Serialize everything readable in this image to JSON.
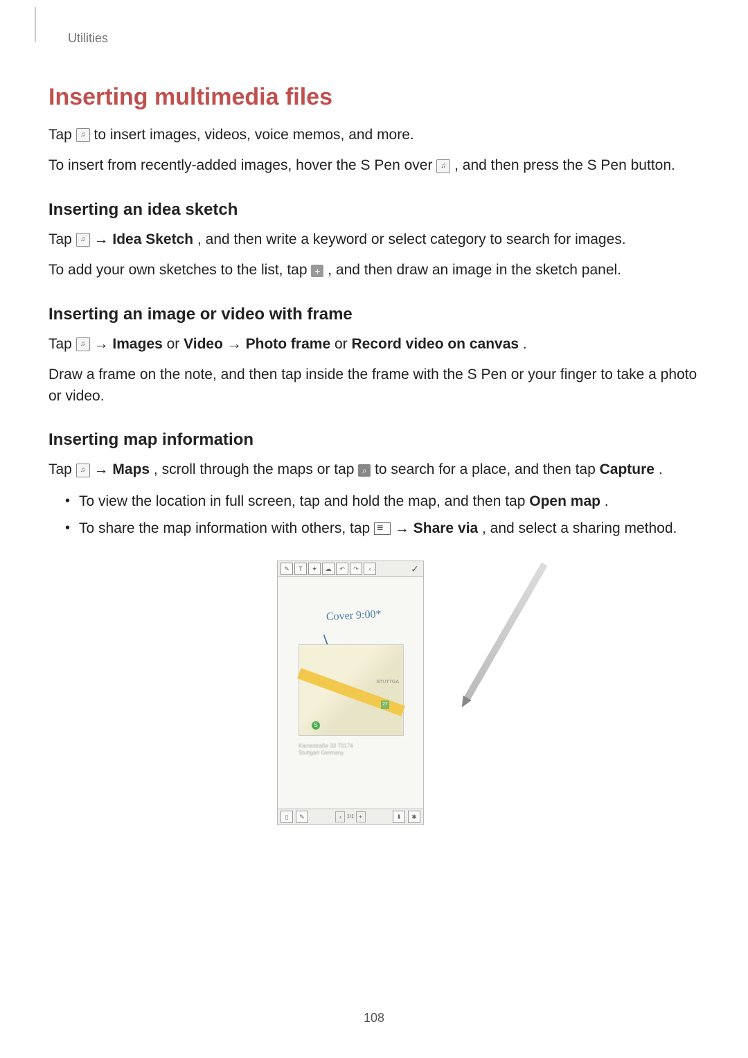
{
  "header": {
    "section": "Utilities"
  },
  "title": "Inserting multimedia files",
  "p1a": "Tap ",
  "p1b": " to insert images, videos, voice memos, and more.",
  "p2a": "To insert from recently-added images, hover the S Pen over ",
  "p2b": ", and then press the S Pen button.",
  "sec1": {
    "title": "Inserting an idea sketch",
    "p1a": "Tap ",
    "p1b": " → ",
    "p1c": "Idea Sketch",
    "p1d": ", and then write a keyword or select category to search for images.",
    "p2a": "To add your own sketches to the list, tap ",
    "p2b": ", and then draw an image in the sketch panel."
  },
  "sec2": {
    "title": "Inserting an image or video with frame",
    "p1a": "Tap ",
    "p1b": " → ",
    "p1c": "Images",
    "p1d": " or ",
    "p1e": "Video",
    "p1f": " → ",
    "p1g": "Photo frame",
    "p1h": " or ",
    "p1i": "Record video on canvas",
    "p1j": ".",
    "p2": "Draw a frame on the note, and then tap inside the frame with the S Pen or your finger to take a photo or video."
  },
  "sec3": {
    "title": "Inserting map information",
    "p1a": "Tap ",
    "p1b": " → ",
    "p1c": "Maps",
    "p1d": ", scroll through the maps or tap ",
    "p1e": " to search for a place, and then tap ",
    "p1f": "Capture",
    "p1g": ".",
    "b1a": "To view the location in full screen, tap and hold the map, and then tap ",
    "b1b": "Open map",
    "b1c": ".",
    "b2a": "To share the map information with others, tap ",
    "b2b": " → ",
    "b2c": "Share via",
    "b2d": ", and select a sharing method."
  },
  "figure": {
    "handwriting": "Cover 9:00*",
    "map_label": "STUTTGA",
    "marker": "27",
    "station": "S",
    "caption1": "Kienestraße 33 70174",
    "caption2": "Stuttgart Germany",
    "pager": "1/1",
    "toolbar": {
      "t1": "✎",
      "t2": "T",
      "t3": "✦",
      "t4": "☁",
      "t5": "↶",
      "t6": "↷",
      "t7": "‹",
      "check": "✓"
    },
    "bottom": {
      "b1": "▯",
      "b2": "✎",
      "prev": "‹",
      "next": "+",
      "b3": "⬇",
      "b4": "✱"
    }
  },
  "page_number": "108"
}
